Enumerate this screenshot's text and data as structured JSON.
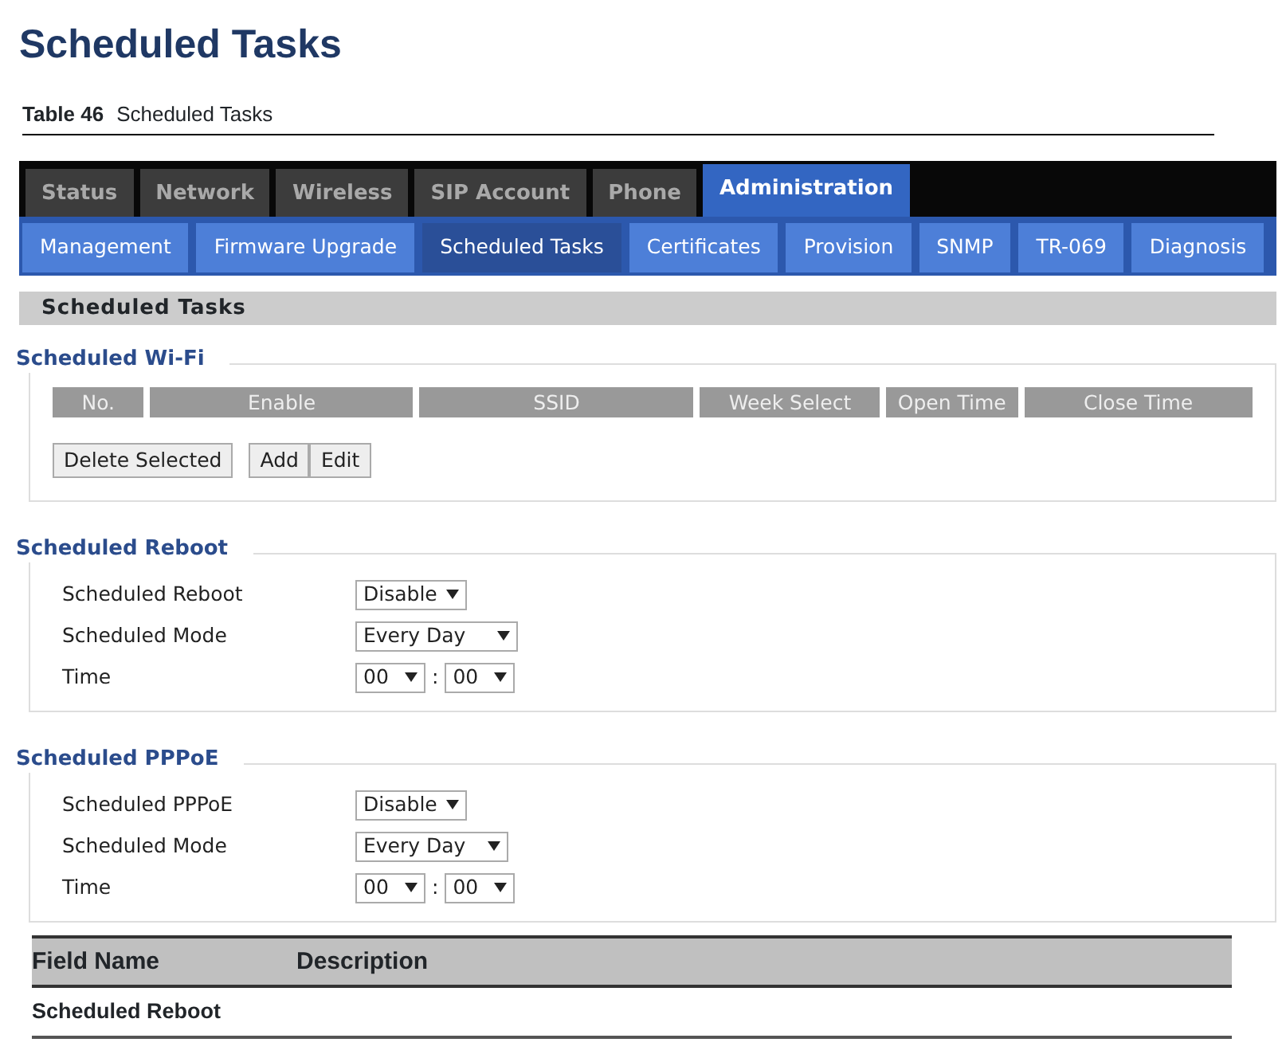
{
  "doc_title": "Scheduled Tasks",
  "table_caption": {
    "label": "Table 46",
    "title": "Scheduled Tasks"
  },
  "main_tabs": [
    {
      "label": "Status",
      "selected": false
    },
    {
      "label": "Network",
      "selected": false
    },
    {
      "label": "Wireless",
      "selected": false
    },
    {
      "label": "SIP Account",
      "selected": false
    },
    {
      "label": "Phone",
      "selected": false
    },
    {
      "label": "Administration",
      "selected": true
    }
  ],
  "sub_tabs": [
    {
      "label": "Management",
      "selected": false
    },
    {
      "label": "Firmware Upgrade",
      "selected": false
    },
    {
      "label": "Scheduled Tasks",
      "selected": true
    },
    {
      "label": "Certificates",
      "selected": false
    },
    {
      "label": "Provision",
      "selected": false
    },
    {
      "label": "SNMP",
      "selected": false
    },
    {
      "label": "TR-069",
      "selected": false
    },
    {
      "label": "Diagnosis",
      "selected": false
    }
  ],
  "section_title": "Scheduled Tasks",
  "wifi": {
    "legend": "Scheduled Wi-Fi",
    "columns": [
      "No.",
      "Enable",
      "SSID",
      "Week Select",
      "Open Time",
      "Close Time"
    ],
    "buttons": [
      "Delete Selected",
      "Add",
      "Edit"
    ]
  },
  "groups": [
    {
      "legend": "Scheduled Reboot",
      "fields": [
        {
          "label": "Scheduled Reboot",
          "kind": "select",
          "value": "Disable"
        },
        {
          "label": "Scheduled Mode",
          "kind": "select",
          "value": "Every Day"
        },
        {
          "label": "Time",
          "kind": "time",
          "hour": "00",
          "separator": ":",
          "minute": "00"
        }
      ]
    },
    {
      "legend": "Scheduled PPPoE",
      "fields": [
        {
          "label": "Scheduled PPPoE",
          "kind": "select",
          "value": "Disable"
        },
        {
          "label": "Scheduled Mode",
          "kind": "select",
          "value": "Every Day"
        },
        {
          "label": "Time",
          "kind": "time",
          "hour": "00",
          "separator": ":",
          "minute": "00"
        }
      ]
    }
  ],
  "desc_table": {
    "columns": [
      "Field Name",
      "Description"
    ],
    "rows": [
      [
        "Scheduled Reboot",
        ""
      ]
    ]
  }
}
